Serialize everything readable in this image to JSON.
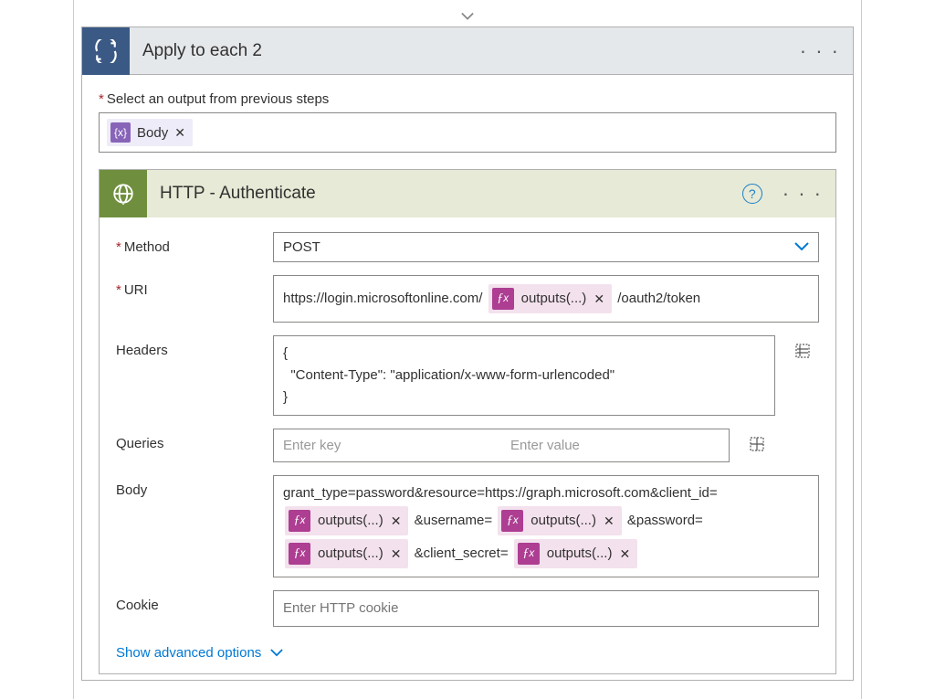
{
  "outer": {
    "title": "Apply to each 2",
    "select_label": "Select an output from previous steps",
    "token": {
      "label": "Body"
    }
  },
  "http": {
    "title": "HTTP - Authenticate",
    "method": {
      "label": "Method",
      "value": "POST"
    },
    "uri": {
      "label": "URI",
      "prefix": "https://login.microsoftonline.com/",
      "token": "outputs(...)",
      "suffix": "/oauth2/token"
    },
    "headers": {
      "label": "Headers",
      "value": "{\n  \"Content-Type\": \"application/x-www-form-urlencoded\"\n}"
    },
    "queries": {
      "label": "Queries",
      "key_placeholder": "Enter key",
      "val_placeholder": "Enter value"
    },
    "body": {
      "label": "Body",
      "line1": "grant_type=password&resource=https://graph.microsoft.com&client_id=",
      "t1": "outputs(...)",
      "s1": " &username=",
      "t2": "outputs(...)",
      "s2": " &password=",
      "t3": "outputs(...)",
      "s3": " &client_secret=",
      "t4": "outputs(...)"
    },
    "cookie": {
      "label": "Cookie",
      "placeholder": "Enter HTTP cookie"
    },
    "advanced": "Show advanced options"
  }
}
